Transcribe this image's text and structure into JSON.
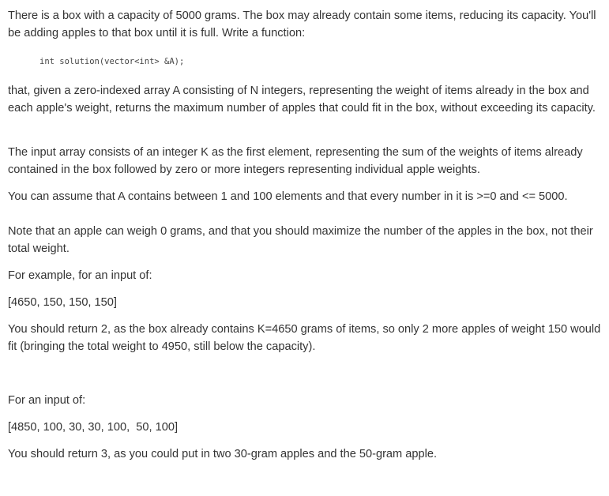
{
  "document": {
    "intro": "There is a box with a capacity of 5000 grams. The box may already contain some items, reducing its capacity. You'll be adding apples to that box until it is full. Write a function:",
    "signature": "int solution(vector<int> &A);",
    "given": "that, given a zero-indexed array A consisting of N integers, representing the weight of items already in the box and each apple's weight, returns the maximum number of apples that could fit in the box, without exceeding its capacity.",
    "input_desc": "The input array consists of an integer K as the first element, representing the sum of the weights of items already contained in the box followed by zero or more integers representing individual apple weights.",
    "assume": "You can assume that A contains between 1 and 100 elements and that every number in it is >=0 and <= 5000.",
    "note": "Note that an apple can weigh 0 grams, and that you should maximize the number of the apples in the box, not their total weight.",
    "example_intro": "For example, for an input of:",
    "example1_input": "[4650, 150, 150, 150]",
    "example1_result": "You should return 2, as the box already contains K=4650 grams of items, so only 2 more apples of weight 150 would fit (bringing the total weight to 4950, still below the capacity).",
    "example2_intro": "For an input of:",
    "example2_input": "[4850, 100, 30, 30, 100,  50, 100]",
    "example2_result": "You should return 3, as you could put in two 30-gram apples and the 50-gram apple."
  }
}
